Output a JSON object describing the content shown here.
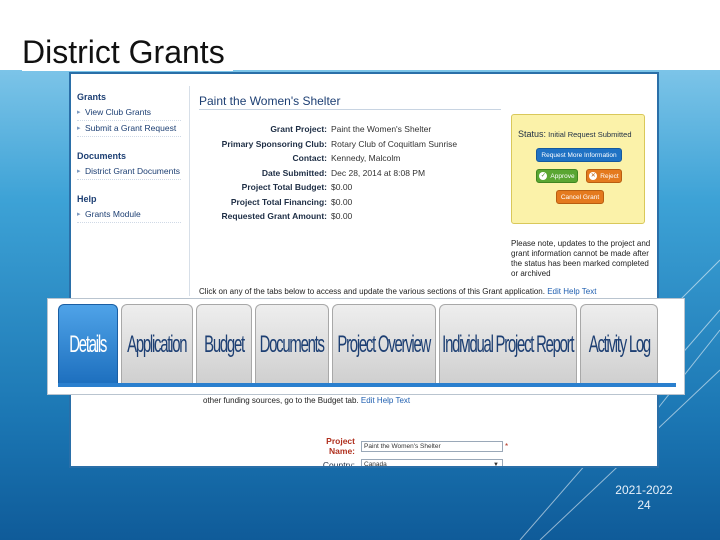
{
  "slide": {
    "title": "District Grants",
    "footer_year": "2021-2022",
    "footer_page": "24"
  },
  "left_nav": {
    "grants_heading": "Grants",
    "grants_items": [
      "View Club Grants",
      "Submit a Grant Request"
    ],
    "documents_heading": "Documents",
    "documents_items": [
      "District Grant Documents"
    ],
    "help_heading": "Help",
    "help_items": [
      "Grants Module"
    ]
  },
  "page": {
    "heading": "Paint the Women's Shelter",
    "details": [
      {
        "label": "Grant Project:",
        "value": "Paint the Women's Shelter"
      },
      {
        "label": "Primary Sponsoring Club:",
        "value": "Rotary Club of Coquitlam Sunrise"
      },
      {
        "label": "Contact:",
        "value": "Kennedy, Malcolm"
      },
      {
        "label": "Date Submitted:",
        "value": "Dec 28, 2014 at 8:08 PM"
      },
      {
        "label": "Project Total Budget:",
        "value": "$0.00"
      },
      {
        "label": "Project Total Financing:",
        "value": "$0.00"
      },
      {
        "label": "Requested Grant Amount:",
        "value": "$0.00"
      }
    ],
    "instruction_text": "Click on any of the tabs below to access and update the various sections of this Grant application.",
    "edit_help_label": "Edit Help Text",
    "lower_note": "other funding sources, go to the Budget tab.",
    "lower_edit_help": "Edit Help Text"
  },
  "status": {
    "label": "Status:",
    "value": "Initial Request Submitted",
    "request_more_label": "Request More Information",
    "approve_label": "Approve",
    "reject_label": "Reject",
    "cancel_label": "Cancel Grant",
    "note": "Please note, updates to the project and grant information cannot be made after the status has been marked completed or archived"
  },
  "tabs": {
    "active_index": 0,
    "items": [
      "Details",
      "Application",
      "Budget",
      "Documents",
      "Project Overview",
      "Individual Project Report",
      "Activity Log"
    ]
  },
  "form": {
    "project_name_label": "Project Name:",
    "project_name_value": "Paint the Women's Shelter",
    "country_label": "Country:",
    "country_value": "Canada"
  },
  "colors": {
    "accent": "#1f72c4",
    "status_bg": "#fbf2a9",
    "approve": "#5aa632",
    "reject": "#e47a1e"
  }
}
